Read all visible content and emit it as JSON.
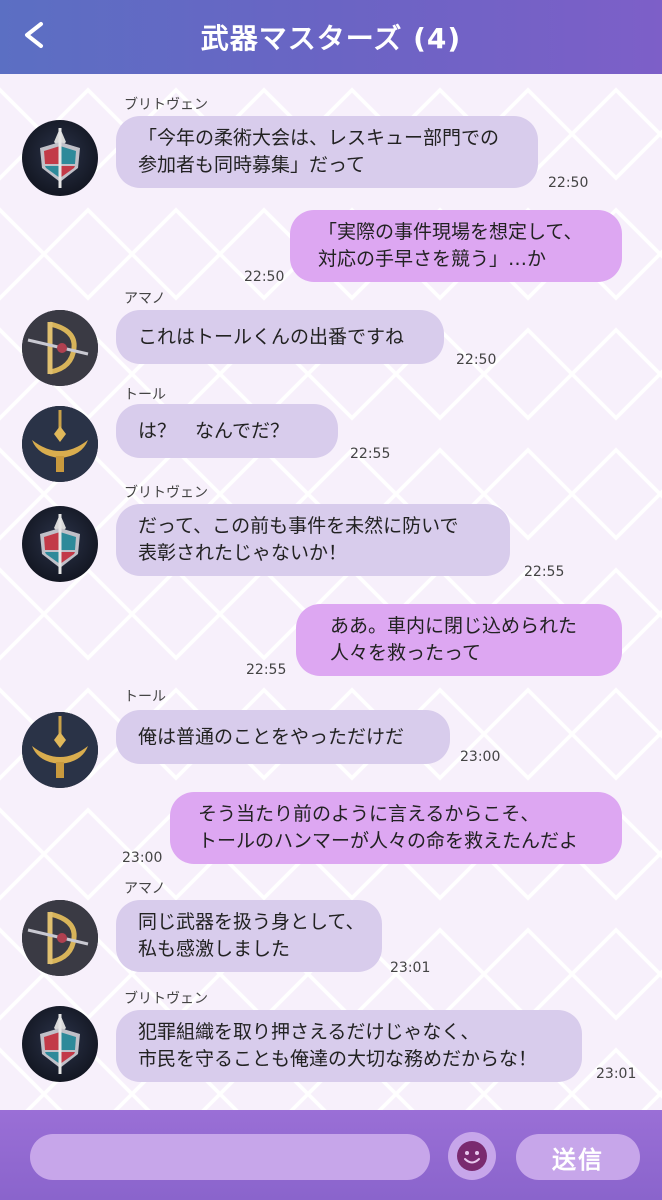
{
  "header": {
    "title": "武器マスターズ (4)",
    "back_icon": "chevron-left-icon"
  },
  "messages": [
    {
      "sender": "ブリトヴェン",
      "avatar": "britoven",
      "dir": "in",
      "lines": [
        "「今年の柔術大会は、レスキュー部門での",
        "参加者も同時募集」だって"
      ],
      "time": "22:50"
    },
    {
      "sender": "",
      "dir": "out",
      "lines": [
        "「実際の事件現場を想定して、",
        "対応の手早さを競う」…か"
      ],
      "time": "22:50"
    },
    {
      "sender": "アマノ",
      "avatar": "amano",
      "dir": "in",
      "lines": [
        "これはトールくんの出番ですね"
      ],
      "time": "22:50"
    },
    {
      "sender": "トール",
      "avatar": "thor",
      "dir": "in",
      "lines": [
        "は？　なんでだ？"
      ],
      "time": "22:55"
    },
    {
      "sender": "ブリトヴェン",
      "avatar": "britoven",
      "dir": "in",
      "lines": [
        "だって、この前も事件を未然に防いで",
        "表彰されたじゃないか！"
      ],
      "time": "22:55"
    },
    {
      "sender": "",
      "dir": "out",
      "lines": [
        "ああ。車内に閉じ込められた",
        "人々を救ったって"
      ],
      "time": "22:55"
    },
    {
      "sender": "トール",
      "avatar": "thor",
      "dir": "in",
      "lines": [
        "俺は普通のことをやっただけだ"
      ],
      "time": "23:00"
    },
    {
      "sender": "",
      "dir": "out",
      "lines": [
        "そう当たり前のように言えるからこそ、",
        "トールのハンマーが人々の命を救えたんだよ"
      ],
      "time": "23:00"
    },
    {
      "sender": "アマノ",
      "avatar": "amano",
      "dir": "in",
      "lines": [
        "同じ武器を扱う身として、",
        "私も感激しました"
      ],
      "time": "23:01"
    },
    {
      "sender": "ブリトヴェン",
      "avatar": "britoven",
      "dir": "in",
      "lines": [
        "犯罪組織を取り押さえるだけじゃなく、",
        "市民を守ることも俺達の大切な務めだからな！"
      ],
      "time": "23:01"
    }
  ],
  "footer": {
    "input_placeholder": "",
    "emoji_icon": "smiley-icon",
    "send_label": "送信"
  },
  "colors": {
    "header": "#6a64c4",
    "bubble_in": "#d8ccec",
    "bubble_out": "#dda7f2",
    "footer": "#9a6fd6"
  }
}
